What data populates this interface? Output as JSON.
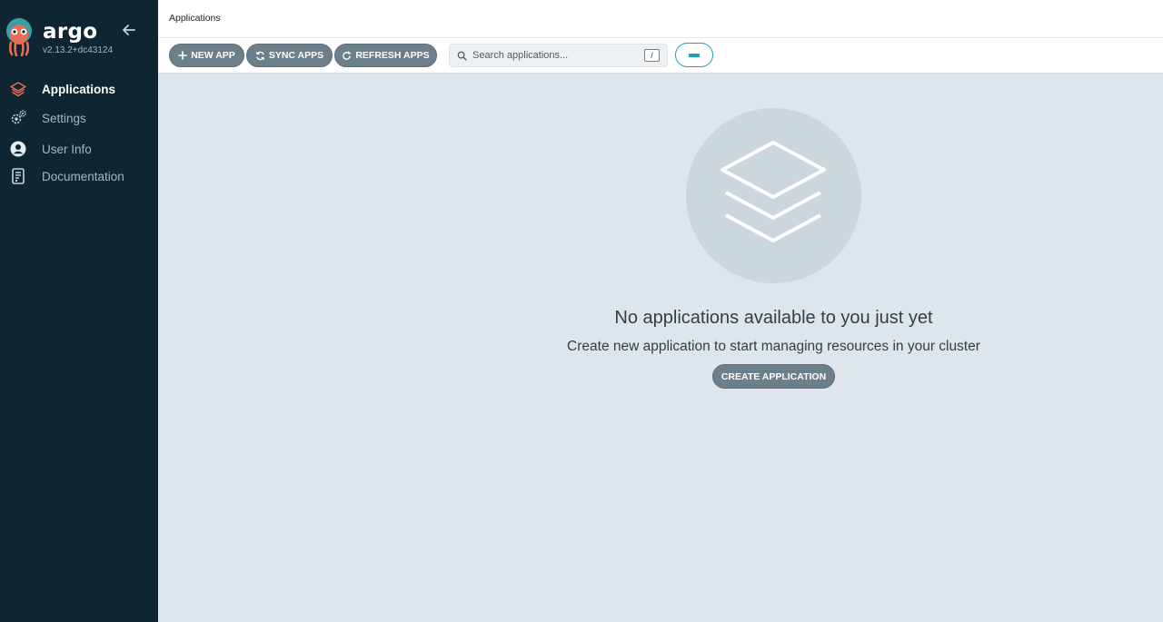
{
  "sidebar": {
    "brand": "argo",
    "version": "v2.13.2+dc43124",
    "items": [
      {
        "label": "Applications",
        "icon": "layers-icon",
        "active": true
      },
      {
        "label": "Settings",
        "icon": "gears-icon",
        "active": false
      },
      {
        "label": "User Info",
        "icon": "user-circle-icon",
        "active": false
      },
      {
        "label": "Documentation",
        "icon": "document-icon",
        "active": false
      }
    ]
  },
  "header": {
    "title": "Applications"
  },
  "toolbar": {
    "new_app_label": "NEW APP",
    "sync_apps_label": "SYNC APPS",
    "refresh_apps_label": "REFRESH APPS",
    "search_placeholder": "Search applications...",
    "search_shortcut": "/"
  },
  "empty_state": {
    "title": "No applications available to you just yet",
    "subtitle": "Create new application to start managing resources in your cluster",
    "button_label": "CREATE APPLICATION"
  },
  "colors": {
    "sidebar_bg": "#0f2532",
    "accent_orange": "#e96d56",
    "accent_teal": "#17a2b8",
    "button_gray": "#6d7f8b",
    "content_bg": "#dee6eb"
  }
}
